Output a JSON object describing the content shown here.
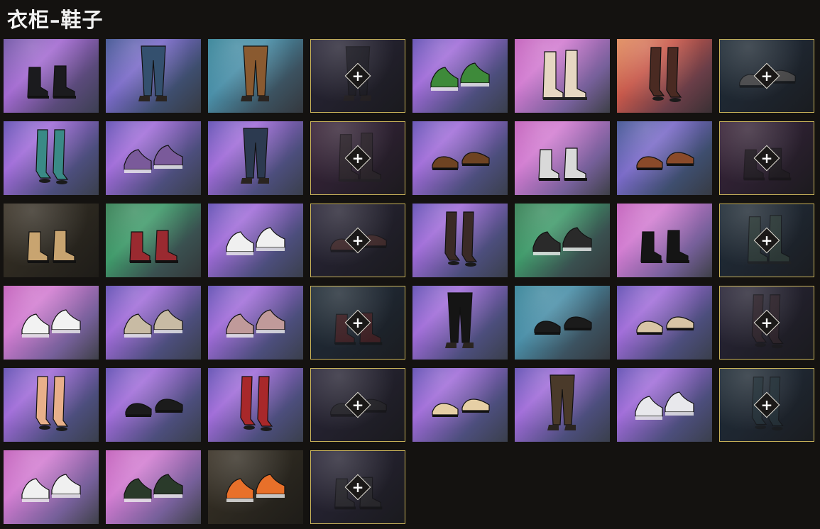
{
  "page": {
    "title": "衣柜–鞋子"
  },
  "tiles": [
    {
      "bg": "purple",
      "item": "boots",
      "color": "#1b1b1e",
      "locked": false
    },
    {
      "bg": "blue",
      "item": "pants",
      "color": "#34506e",
      "locked": false
    },
    {
      "bg": "teal",
      "item": "pants",
      "color": "#8a5a30",
      "locked": false
    },
    {
      "bg": "dark",
      "item": "pants",
      "color": "#1d1d22",
      "locked": true
    },
    {
      "bg": "violet",
      "item": "sneakers",
      "color": "#3e8a3a",
      "locked": false
    },
    {
      "bg": "pink",
      "item": "tallboots",
      "color": "#e6d7c2",
      "locked": false
    },
    {
      "bg": "orange",
      "item": "stockings",
      "color": "#4a2a22",
      "locked": false
    },
    {
      "bg": "darkteal",
      "item": "shoes",
      "color": "#6b6560",
      "locked": true
    },
    {
      "bg": "violet",
      "item": "stockings",
      "color": "#3a8a86",
      "locked": false
    },
    {
      "bg": "violet",
      "item": "sneakers",
      "color": "#7a5a9a",
      "locked": false
    },
    {
      "bg": "violet",
      "item": "pants",
      "color": "#2c3a50",
      "locked": false
    },
    {
      "bg": "darkpink",
      "item": "tallboots",
      "color": "#2e2a2a",
      "locked": true
    },
    {
      "bg": "violet",
      "item": "shoes",
      "color": "#6e4322",
      "locked": false
    },
    {
      "bg": "pink",
      "item": "boots",
      "color": "#d9d9d9",
      "locked": false
    },
    {
      "bg": "blue",
      "item": "shoes",
      "color": "#8a4a2a",
      "locked": false
    },
    {
      "bg": "darkpink",
      "item": "boots",
      "color": "#1c1c1c",
      "locked": true
    },
    {
      "bg": "brown",
      "item": "boots",
      "color": "#c8a470",
      "locked": false
    },
    {
      "bg": "green",
      "item": "boots",
      "color": "#9a2a30",
      "locked": false
    },
    {
      "bg": "violet",
      "item": "sneakers",
      "color": "#f0f0f0",
      "locked": false
    },
    {
      "bg": "dark",
      "item": "shoes",
      "color": "#5a3630",
      "locked": true
    },
    {
      "bg": "violet",
      "item": "stockings",
      "color": "#3a2a26",
      "locked": false
    },
    {
      "bg": "green",
      "item": "sneakers",
      "color": "#2a2a2a",
      "locked": false
    },
    {
      "bg": "pink",
      "item": "boots",
      "color": "#151515",
      "locked": false
    },
    {
      "bg": "darkteal",
      "item": "tallboots",
      "color": "#3a4a40",
      "locked": true
    },
    {
      "bg": "pink",
      "item": "sneakers",
      "color": "#f2f2f2",
      "locked": false
    },
    {
      "bg": "violet",
      "item": "sneakers",
      "color": "#c8bba4",
      "locked": false
    },
    {
      "bg": "violet",
      "item": "sneakers",
      "color": "#c09a9a",
      "locked": false
    },
    {
      "bg": "darkteal",
      "item": "boots",
      "color": "#5a2020",
      "locked": true
    },
    {
      "bg": "violet",
      "item": "pants",
      "color": "#151515",
      "locked": false
    },
    {
      "bg": "teal",
      "item": "shoes",
      "color": "#1b1b1b",
      "locked": false
    },
    {
      "bg": "violet",
      "item": "shoes",
      "color": "#d8c5a6",
      "locked": false
    },
    {
      "bg": "dark",
      "item": "stockings",
      "color": "#3a2a2e",
      "locked": true
    },
    {
      "bg": "violet",
      "item": "stockings",
      "color": "#e8b08a",
      "locked": false
    },
    {
      "bg": "violet",
      "item": "shoes",
      "color": "#1b1b1b",
      "locked": false
    },
    {
      "bg": "violet",
      "item": "stockings",
      "color": "#a8282a",
      "locked": false
    },
    {
      "bg": "dark",
      "item": "shoes",
      "color": "#2a2a2a",
      "locked": true
    },
    {
      "bg": "violet",
      "item": "shoes",
      "color": "#e6cfa5",
      "locked": false
    },
    {
      "bg": "violet",
      "item": "pants",
      "color": "#4a3a2a",
      "locked": false
    },
    {
      "bg": "violet",
      "item": "sneakers",
      "color": "#e8e8ec",
      "locked": false
    },
    {
      "bg": "darkteal",
      "item": "stockings",
      "color": "#2a3a40",
      "locked": true
    },
    {
      "bg": "pink",
      "item": "sneakers",
      "color": "#f0f0f0",
      "locked": false
    },
    {
      "bg": "pink",
      "item": "sneakers",
      "color": "#2a3a2a",
      "locked": false
    },
    {
      "bg": "brown",
      "item": "sneakers",
      "color": "#e8702a",
      "locked": false
    },
    {
      "bg": "dark",
      "item": "boots",
      "color": "#303030",
      "locked": true
    }
  ],
  "plus_label": "+"
}
